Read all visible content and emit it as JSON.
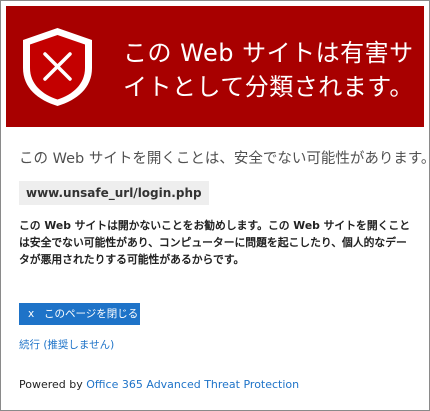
{
  "banner": {
    "title": "この Web サイトは有害サイトとして分類されます。",
    "background_color": "#a80000",
    "icon": "shield-x-icon"
  },
  "content": {
    "subtitle": "この Web サイトを開くことは、安全でない可能性があります。",
    "url": "www.unsafe_url/login.php",
    "warning": "この Web サイトは開かないことをお勧めします。この Web サイトを開くことは安全でない可能性があり、コンピューターに問題を起こしたり、個人的なデータが悪用されたりする可能性があるからです。"
  },
  "actions": {
    "close_button": {
      "icon": "x",
      "label": "このページを閉じる",
      "color": "#1e73c8"
    },
    "continue_link": "続行 (推奨しません)"
  },
  "footer": {
    "powered_by": "Powered by",
    "brand": "Office 365 Advanced Threat Protection",
    "link_color": "#1e73c8"
  }
}
